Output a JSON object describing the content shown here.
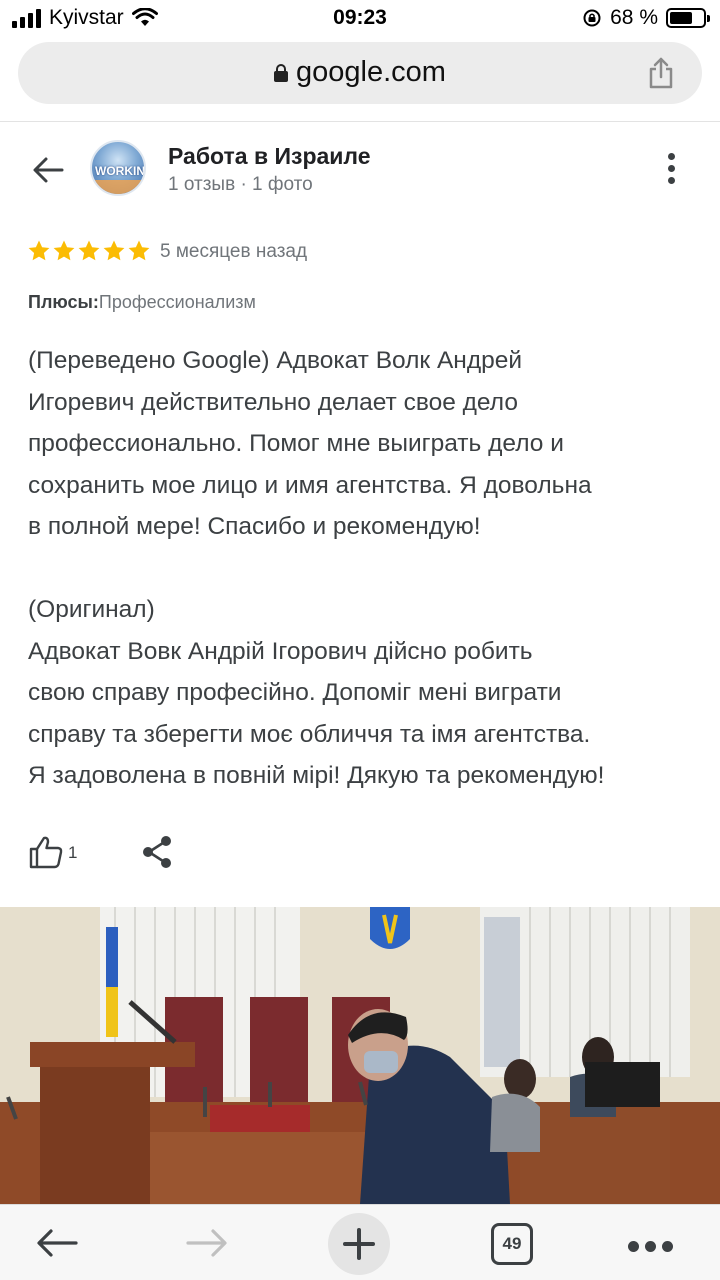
{
  "status_bar": {
    "carrier": "Kyivstar",
    "time": "09:23",
    "battery_percent": "68 %",
    "battery_level": 0.68
  },
  "browser": {
    "url": "google.com",
    "open_tabs": "49"
  },
  "place": {
    "title": "Работа в Израиле",
    "meta": "1 отзыв · 1 фото",
    "avatar_logo_text": "WORKIN"
  },
  "review": {
    "rating": 5,
    "time": "5 месяцев назад",
    "pros_label": "Плюсы:",
    "pros_value": "Профессионализм",
    "translated": [
      "(Переведено Google) Адвокат Волк Андрей",
      "Игоревич действительно делает свое дело",
      "профессионально. Помог мне выиграть дело и",
      "сохранить мое лицо и имя агентства. Я довольна",
      "в полной мере! Спасибо и рекомендую!"
    ],
    "original": [
      "(Оригинал)",
      "Адвокат Вовк Андрій Ігорович дійсно робить",
      "свою справу професійно. Допоміг мені виграти",
      "справу та зберегти моє обличчя та імя агентства.",
      "Я задоволена в повній мірі! Дякую та рекомендую!"
    ],
    "likes": "1"
  },
  "colors": {
    "star": "#fbbc04",
    "text_secondary": "#70757a",
    "text_primary": "#3c4043"
  },
  "icons": {
    "lock": "lock-icon",
    "share": "share-icon",
    "back": "arrow-left-icon",
    "menu": "more-vertical-icon",
    "like": "thumbs-up-icon",
    "share_review": "share-nodes-icon"
  }
}
